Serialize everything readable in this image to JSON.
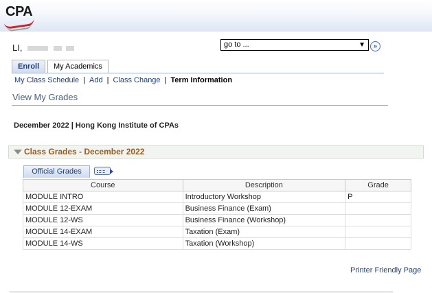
{
  "brand": {
    "logo_text": "CPA"
  },
  "user": {
    "name_visible": "LI, "
  },
  "nav": {
    "goto_value": "go to ...",
    "goto_button_glyph": "»"
  },
  "tabs": [
    {
      "label": "Enroll"
    },
    {
      "label": "My Academics"
    }
  ],
  "subnav": {
    "items": [
      "My Class Schedule",
      "Add",
      "Class Change"
    ],
    "current": "Term Information",
    "separator": "|"
  },
  "page": {
    "title": "View My Grades",
    "term_line": "December 2022 | Hong Kong Institute of CPAs"
  },
  "grades_section": {
    "title": "Class Grades - December 2022",
    "tab_label": "Official Grades",
    "columns": [
      "Course",
      "Description",
      "Grade"
    ],
    "rows": [
      {
        "course": "MODULE INTRO",
        "description": "Introductory Workshop",
        "grade": "P"
      },
      {
        "course": "MODULE 12-EXAM",
        "description": "Business Finance (Exam)",
        "grade": ""
      },
      {
        "course": "MODULE 12-WS",
        "description": "Business Finance (Workshop)",
        "grade": ""
      },
      {
        "course": "MODULE 14-EXAM",
        "description": "Taxation (Exam)",
        "grade": ""
      },
      {
        "course": "MODULE 14-WS",
        "description": "Taxation (Workshop)",
        "grade": ""
      }
    ]
  },
  "footer": {
    "printer_link": "Printer Friendly Page"
  },
  "colors": {
    "link": "#1f3e7a",
    "section_title": "#9c5a1a",
    "accent_red": "#c9252c"
  }
}
